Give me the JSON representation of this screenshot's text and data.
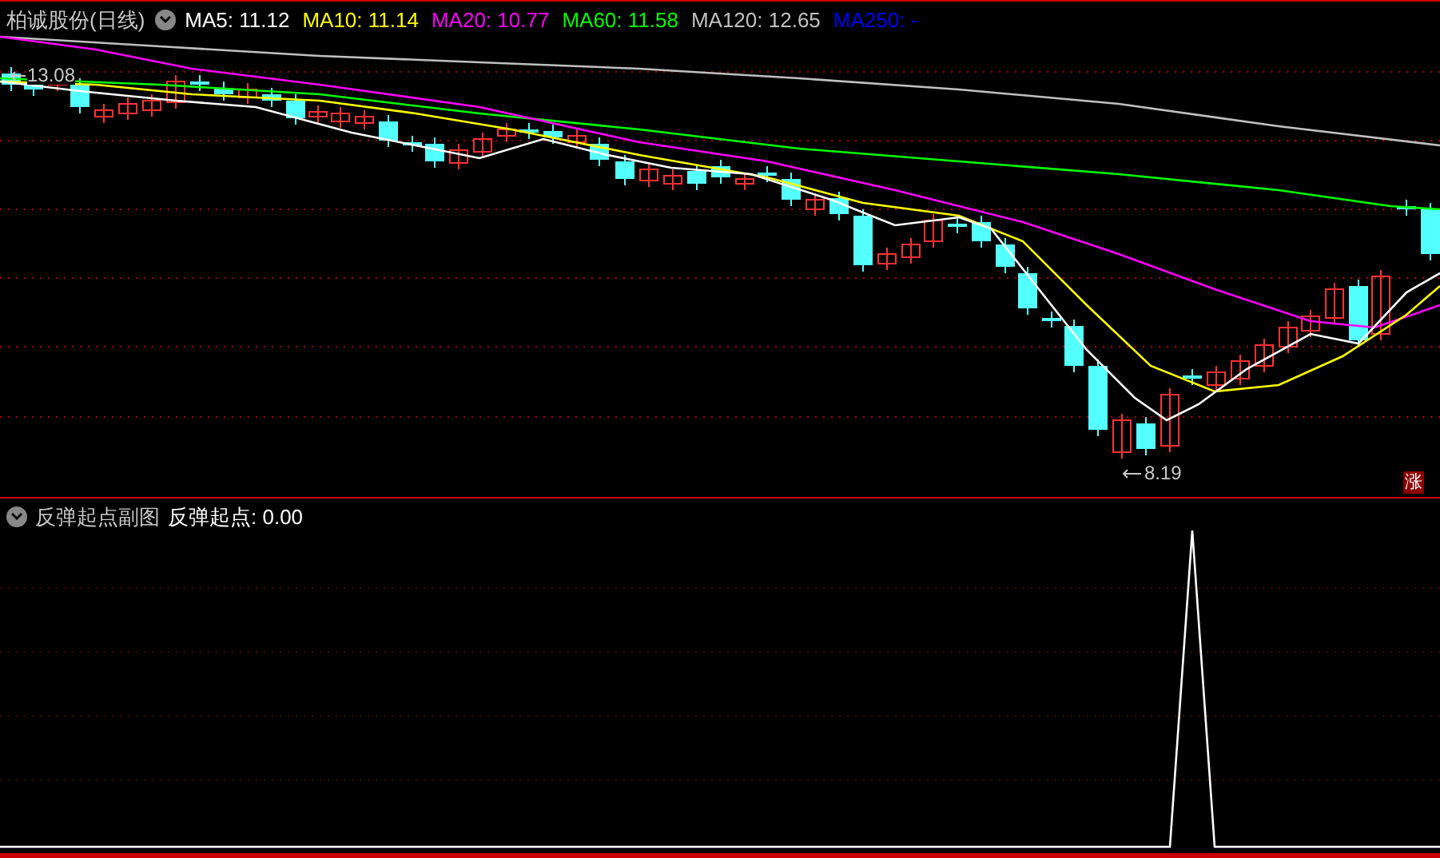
{
  "title": "柏诚股份(日线)",
  "indicators": [
    {
      "label": "MA5: 11.12",
      "color": "#ffffff"
    },
    {
      "label": "MA10: 11.14",
      "color": "#ffff00"
    },
    {
      "label": "MA20: 10.77",
      "color": "#ff00ff"
    },
    {
      "label": "MA60: 11.58",
      "color": "#00ff00"
    },
    {
      "label": "MA120: 12.65",
      "color": "#c0c0c0"
    },
    {
      "label": "MA250: -",
      "color": "#0000ff"
    }
  ],
  "high_label": "13.08",
  "low_label": "8.19",
  "badge": "涨",
  "sub_panel": {
    "title": "反弹起点副图",
    "indicator": {
      "label": "反弹起点: 0.00",
      "color": "#ffffff"
    }
  }
}
